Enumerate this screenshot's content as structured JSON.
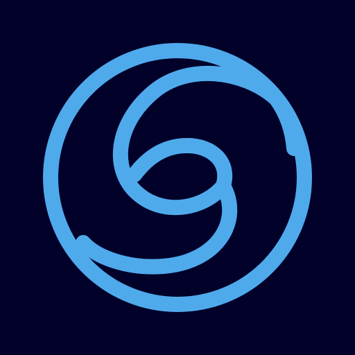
{
  "colors": {
    "background": "#01012a",
    "stroke": "#4faaec"
  },
  "icon": {
    "name": "swirl-circle-icon"
  }
}
